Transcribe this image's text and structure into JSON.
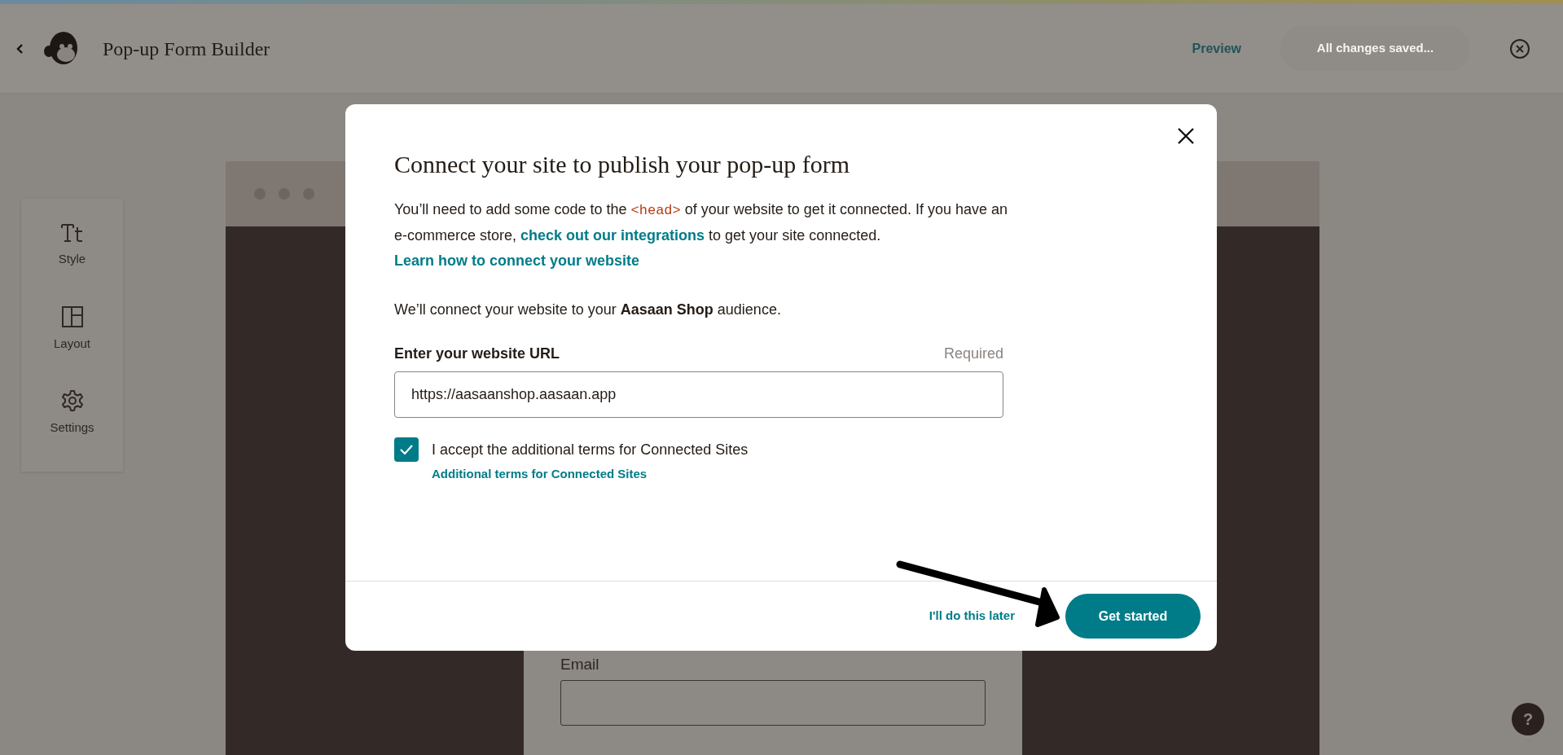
{
  "header": {
    "title": "Pop-up Form Builder",
    "preview": "Preview",
    "save_button": {
      "label": "All changes saved...",
      "disabled": true
    }
  },
  "sidebar": {
    "items": [
      {
        "kind": "style",
        "label": "Style"
      },
      {
        "kind": "layout",
        "label": "Layout"
      },
      {
        "kind": "settings",
        "label": "Settings"
      }
    ]
  },
  "canvas": {
    "field_label": "Email"
  },
  "modal": {
    "title": "Connect your site to publish your pop-up form",
    "paragraphs": [
      [
        {
          "kind": "text",
          "text": "You’ll need to add some code to the "
        },
        {
          "kind": "code",
          "text": "<head>"
        },
        {
          "kind": "text",
          "text": " of your website to get it connected. If you have an e-commerce store, "
        },
        {
          "kind": "link",
          "text": "check out our integrations"
        },
        {
          "kind": "text",
          "text": " to get your site connected. "
        },
        {
          "kind": "link",
          "text": "Learn how to connect your website"
        }
      ],
      [
        {
          "kind": "text",
          "text": "We’ll connect your website to your **Aasaan Shop** audience."
        }
      ]
    ],
    "field": {
      "label": "Enter your website URL",
      "note": "Required",
      "value": "https://aasaanshop.aasaan.app"
    },
    "checkbox": {
      "label": "I accept the additional terms for Connected Sites",
      "checked": true,
      "link": "Additional terms for Connected Sites"
    },
    "secondary": "I'll do this later",
    "primary": "Get started"
  },
  "help_button": "?"
}
